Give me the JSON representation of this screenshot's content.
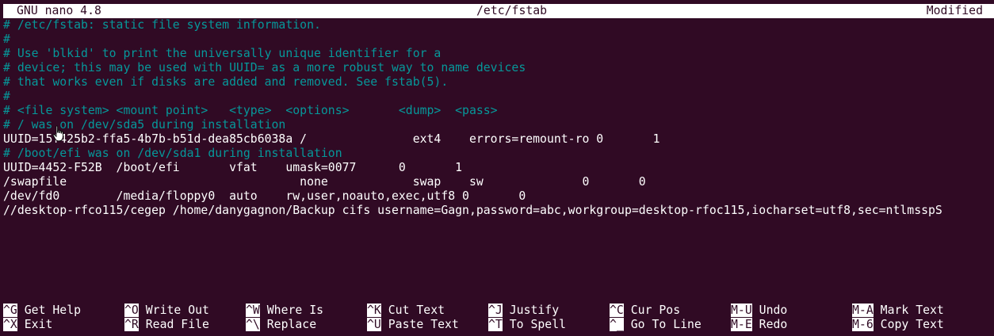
{
  "titlebar": {
    "app": "GNU nano 4.8",
    "file": "/etc/fstab",
    "status": "Modified"
  },
  "editor": {
    "lines": [
      {
        "text": "# /etc/fstab: static file system information.",
        "kind": "comment"
      },
      {
        "text": "#",
        "kind": "comment"
      },
      {
        "text": "# Use 'blkid' to print the universally unique identifier for a",
        "kind": "comment"
      },
      {
        "text": "# device; this may be used with UUID= as a more robust way to name devices",
        "kind": "comment"
      },
      {
        "text": "# that works even if disks are added and removed. See fstab(5).",
        "kind": "comment"
      },
      {
        "text": "#",
        "kind": "comment"
      },
      {
        "text": "# <file system> <mount point>   <type>  <options>       <dump>  <pass>",
        "kind": "comment"
      },
      {
        "text": "# / was on /dev/sda5 during installation",
        "kind": "comment"
      },
      {
        "text": "UUID=15f425b2-ffa5-4b7b-b51d-dea85cb6038a /               ext4    errors=remount-ro 0       1",
        "kind": "plain"
      },
      {
        "text": "# /boot/efi was on /dev/sda1 during installation",
        "kind": "comment"
      },
      {
        "text": "UUID=4452-F52B  /boot/efi       vfat    umask=0077      0       1",
        "kind": "plain"
      },
      {
        "text": "/swapfile                                 none            swap    sw              0       0",
        "kind": "plain"
      },
      {
        "text": "/dev/fd0        /media/floppy0  auto    rw,user,noauto,exec,utf8 0       0",
        "kind": "plain"
      },
      {
        "text": "//desktop-rfco115/cegep /home/danygagnon/Backup cifs username=Gagn,password=abc,workgroup=desktop-rfoc115,iocharset=utf8,sec=ntlmsspS",
        "kind": "plain"
      }
    ]
  },
  "shortcuts": {
    "row1": [
      {
        "key": "^G",
        "label": "Get Help"
      },
      {
        "key": "^O",
        "label": "Write Out"
      },
      {
        "key": "^W",
        "label": "Where Is"
      },
      {
        "key": "^K",
        "label": "Cut Text"
      },
      {
        "key": "^J",
        "label": "Justify"
      },
      {
        "key": "^C",
        "label": "Cur Pos"
      },
      {
        "key": "M-U",
        "label": "Undo"
      },
      {
        "key": "M-A",
        "label": "Mark Text"
      }
    ],
    "row2": [
      {
        "key": "^X",
        "label": "Exit"
      },
      {
        "key": "^R",
        "label": "Read File"
      },
      {
        "key": "^\\",
        "label": "Replace"
      },
      {
        "key": "^U",
        "label": "Paste Text"
      },
      {
        "key": "^T",
        "label": "To Spell"
      },
      {
        "key": "^_",
        "label": "Go To Line"
      },
      {
        "key": "M-E",
        "label": "Redo"
      },
      {
        "key": "M-6",
        "label": "Copy Text"
      }
    ]
  },
  "pointer": {
    "icon": "hand-pointer-icon"
  }
}
